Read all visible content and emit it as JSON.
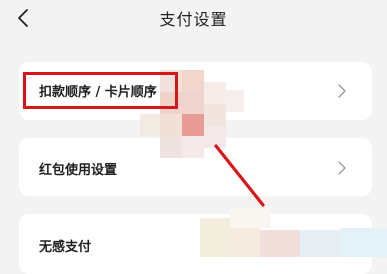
{
  "header": {
    "title": "支付设置",
    "back_icon": "chevron-left-icon"
  },
  "settings": {
    "items": [
      {
        "label": "扣款顺序 / 卡片顺序",
        "chevron_icon": "chevron-right-icon"
      },
      {
        "label": "红包使用设置",
        "chevron_icon": "chevron-right-icon"
      },
      {
        "label": "无感支付"
      }
    ]
  },
  "annotation": {
    "highlight_color": "#d8151b"
  }
}
